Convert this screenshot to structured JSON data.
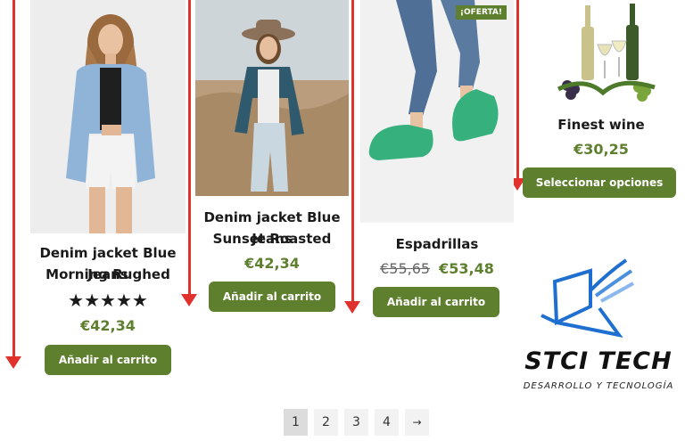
{
  "products": [
    {
      "title_line1": "Denim jacket Blue Jeans",
      "title_line2": "Morning Rughed",
      "rating_stars": "★★★★★",
      "rating": 5,
      "price": "€42,34",
      "button": "Añadir al carrito"
    },
    {
      "title_line1": "Denim jacket Blue Jeans",
      "title_line2": "Sunset Roasted",
      "price": "€42,34",
      "button": "Añadir al carrito"
    },
    {
      "badge": "¡OFERTA!",
      "title": "Espadrillas",
      "old_price": "€55,65",
      "price": "€53,48",
      "button": "Añadir al carrito"
    },
    {
      "title": "Finest wine",
      "price": "€30,25",
      "button": "Seleccionar opciones"
    }
  ],
  "logo": {
    "name": "STCI TECH",
    "tagline": "DESARROLLO Y TECNOLOGÍA"
  },
  "pagination": {
    "pages": [
      "1",
      "2",
      "3",
      "4"
    ],
    "current": "1",
    "next": "→"
  },
  "colors": {
    "accent": "#5e7f2e",
    "arrow": "#e0312d",
    "logo_blue": "#1f6fd1"
  }
}
